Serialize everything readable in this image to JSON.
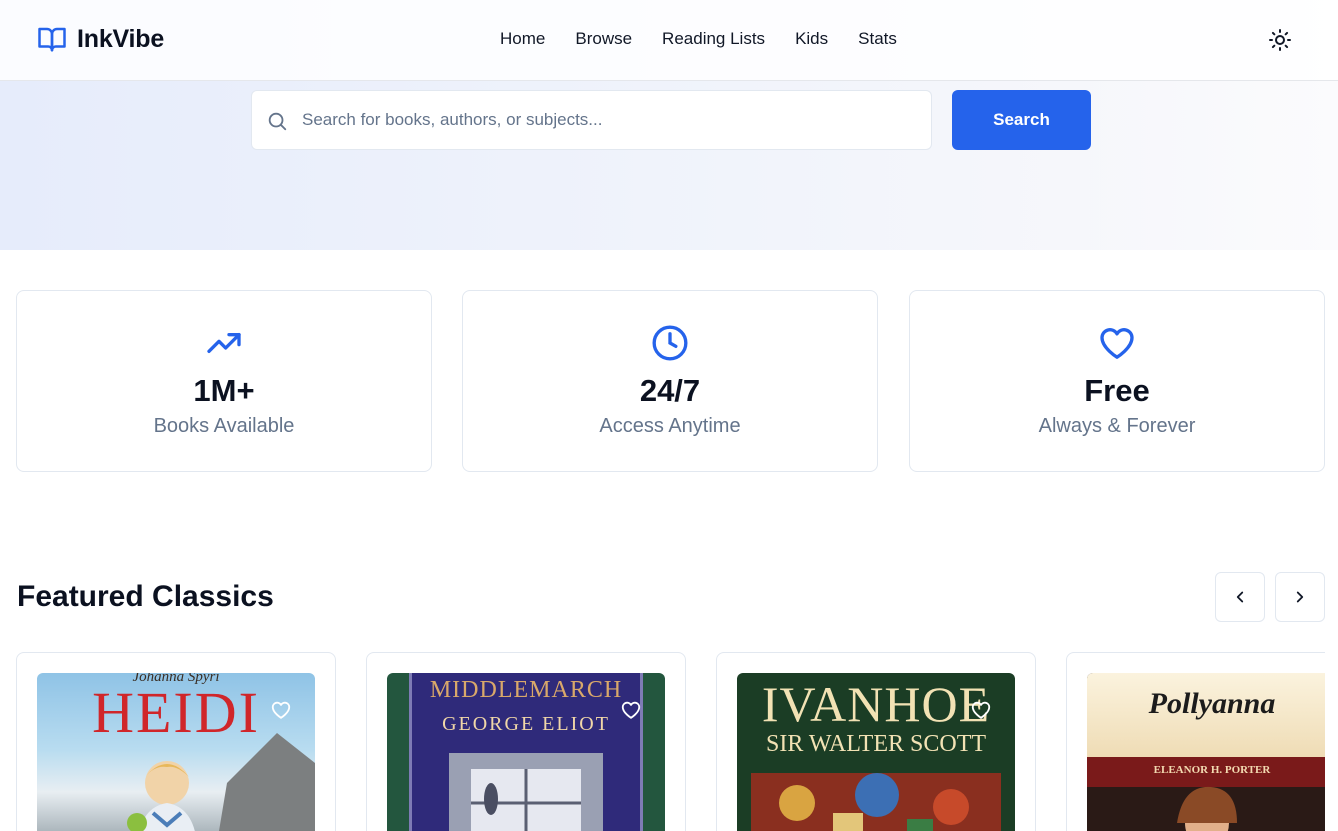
{
  "brand": {
    "name": "InkVibe",
    "icon": "open-book-icon",
    "accent": "#2563eb"
  },
  "nav": {
    "links": [
      "Home",
      "Browse",
      "Reading Lists",
      "Kids",
      "Stats"
    ],
    "theme_icon": "sun-icon"
  },
  "search": {
    "placeholder": "Search for books, authors, or subjects...",
    "value": "",
    "button_label": "Search",
    "icon": "search-icon"
  },
  "stats": [
    {
      "value": "1M+",
      "label": "Books Available",
      "icon": "trending-up-icon"
    },
    {
      "value": "24/7",
      "label": "Access Anytime",
      "icon": "clock-icon"
    },
    {
      "value": "Free",
      "label": "Always & Forever",
      "icon": "heart-icon"
    }
  ],
  "featured": {
    "title": "Featured Classics",
    "prev_icon": "chevron-left-icon",
    "next_icon": "chevron-right-icon",
    "books": [
      {
        "cover_title": "HEIDI",
        "cover_author": "Johanna Spyri"
      },
      {
        "cover_title": "MIDDLEMARCH",
        "cover_author": "GEORGE ELIOT"
      },
      {
        "cover_title": "IVANHOE",
        "cover_author": "SIR WALTER SCOTT"
      },
      {
        "cover_title": "Pollyanna",
        "cover_author": "ELEANOR H. PORTER"
      }
    ]
  }
}
